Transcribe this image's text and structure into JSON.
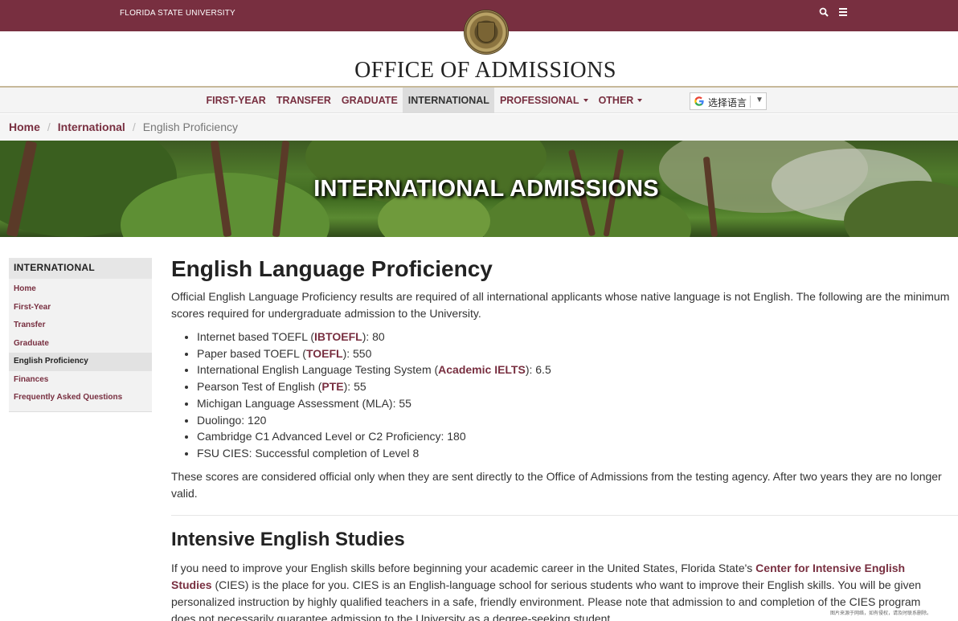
{
  "topbar": {
    "university": "FLORIDA STATE UNIVERSITY",
    "search_icon": "search-icon",
    "menu_icon": "hamburger-menu-icon",
    "color": "#782f40"
  },
  "header": {
    "seal_icon": "university-seal-icon",
    "office_title": "OFFICE OF ADMISSIONS"
  },
  "nav": {
    "items": [
      {
        "label": "FIRST-YEAR"
      },
      {
        "label": "TRANSFER"
      },
      {
        "label": "GRADUATE"
      },
      {
        "label": "INTERNATIONAL",
        "active": true
      },
      {
        "label": "PROFESSIONAL",
        "dropdown": true
      },
      {
        "label": "OTHER",
        "dropdown": true
      }
    ],
    "translate_label": "选择语言",
    "translate_arrow": "▼"
  },
  "breadcrumb": {
    "items": [
      "Home",
      "International"
    ],
    "current": "English Proficiency",
    "separator": "/"
  },
  "banner": {
    "title": "INTERNATIONAL ADMISSIONS"
  },
  "sidebar": {
    "title": "INTERNATIONAL",
    "items": [
      {
        "label": "Home"
      },
      {
        "label": "First-Year"
      },
      {
        "label": "Transfer"
      },
      {
        "label": "Graduate"
      },
      {
        "label": "English Proficiency",
        "active": true
      },
      {
        "label": "Finances"
      },
      {
        "label": "Frequently Asked Questions"
      }
    ]
  },
  "main": {
    "title": "English Language Proficiency",
    "intro": "Official English Language Proficiency results are required of all international applicants whose native language is not English. The following are the minimum scores required for undergraduate admission to the University.",
    "scores": [
      {
        "pre": "Internet based TOEFL (",
        "link": "IBTOEFL",
        "post": "): 80"
      },
      {
        "pre": "Paper based TOEFL (",
        "link": "TOEFL",
        "post": "): 550"
      },
      {
        "pre": "International English Language Testing System (",
        "link": "Academic IELTS",
        "post": "): 6.5"
      },
      {
        "pre": "Pearson Test of English (",
        "link": "PTE",
        "post": "): 55"
      },
      {
        "pre": "Michigan Language Assessment (MLA): 55",
        "link": "",
        "post": ""
      },
      {
        "pre": "Duolingo: 120",
        "link": "",
        "post": ""
      },
      {
        "pre": "Cambridge C1 Advanced Level or C2 Proficiency: 180",
        "link": "",
        "post": ""
      },
      {
        "pre": "FSU CIES: Successful completion of Level 8",
        "link": "",
        "post": ""
      }
    ],
    "after": "These scores are considered official only when they are sent directly to the Office of Admissions from the testing agency. After two years they are no longer valid.",
    "section2_title": "Intensive English Studies",
    "section2_pre": "If you need to improve your English skills before beginning your academic career in the United States, Florida State's ",
    "section2_link": "Center for Intensive English Studies",
    "section2_post": " (CIES) is the place for you. CIES is an English-language school for serious students who want to improve their English skills. You will be given personalized instruction by highly qualified teachers in a safe, friendly environment. Please note that admission to and completion of the CIES program does not necessarily guarantee admission to the University as a degree-seeking student."
  },
  "credit": "图片来源于网络，如有侵权，请及时联系删除。"
}
